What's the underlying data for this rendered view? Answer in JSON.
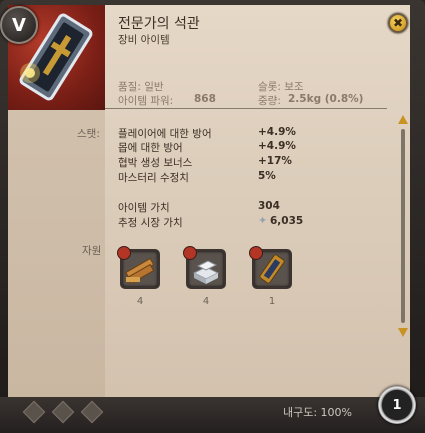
{
  "item": {
    "name": "전문가의 석관",
    "type": "장비 아이템",
    "badge": "V",
    "close_glyph": "✖"
  },
  "info": {
    "quality": "품질: 일반",
    "power_label": "아이템 파워:",
    "power_value": "868",
    "slot": "슬롯: 보조",
    "weight_label": "중량:",
    "weight_value": "2.5kg (0.8%)"
  },
  "stats": {
    "label": "스탯:",
    "rows": [
      {
        "name": "플레이어에 대한 방어",
        "value": "+4.9%"
      },
      {
        "name": "몹에 대한 방어",
        "value": "+4.9%"
      },
      {
        "name": "협박 생성 보너스",
        "value": "+17%"
      },
      {
        "name": "마스터리 수정치",
        "value": "5%"
      }
    ]
  },
  "values": {
    "item_value_label": "아이템 가치",
    "item_value": "304",
    "market_label": "추정 시장 가치",
    "market_value": "6,035"
  },
  "resources": {
    "label": "자원",
    "items": [
      {
        "icon": "wood-planks-icon",
        "count": "4"
      },
      {
        "icon": "metal-bars-icon",
        "count": "4"
      },
      {
        "icon": "artifact-shield-icon",
        "count": "1"
      }
    ]
  },
  "footer": {
    "durability": "내구도: 100%",
    "stack": "1"
  },
  "colors": {
    "panel": "#ddcfbd",
    "accent": "#c99324",
    "portrait_bg": "#8a2418"
  }
}
